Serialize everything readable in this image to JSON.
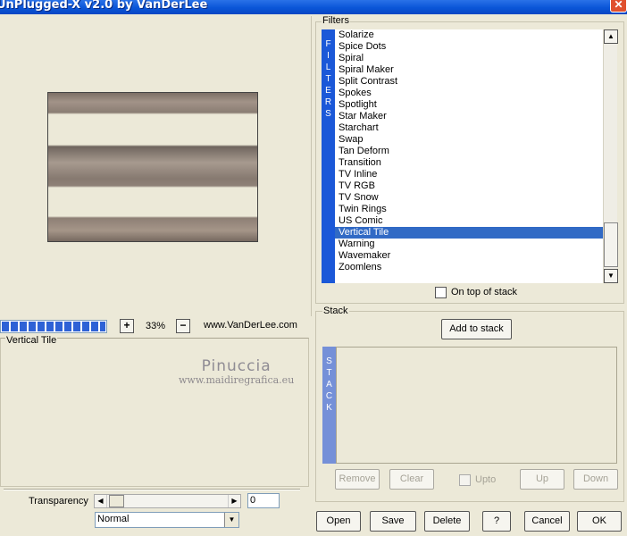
{
  "window": {
    "title": "UnPlugged-X v2.0 by VanDerLee",
    "close_glyph": "✕"
  },
  "zoom": {
    "progress": 1.0,
    "minus_glyph": "−",
    "plus_glyph": "+",
    "value": "33%",
    "website": "www.VanDerLee.com"
  },
  "params": {
    "title": "Vertical Tile",
    "watermark_name": "Pinuccia",
    "watermark_url": "www.maidiregrafica.eu",
    "transparency_label": "Transparency",
    "transparency_value": "0",
    "blend_mode": "Normal"
  },
  "filters": {
    "title": "Filters",
    "sidebar_letters": [
      "F",
      "I",
      "L",
      "T",
      "E",
      "R",
      "S"
    ],
    "items": [
      "Solarize",
      "Spice Dots",
      "Spiral",
      "Spiral Maker",
      "Split Contrast",
      "Spokes",
      "Spotlight",
      "Star Maker",
      "Starchart",
      "Swap",
      "Tan Deform",
      "Transition",
      "TV Inline",
      "TV RGB",
      "TV Snow",
      "Twin Rings",
      "US Comic",
      "Vertical Tile",
      "Warning",
      "Wavemaker",
      "Zoomlens"
    ],
    "selected": "Vertical Tile",
    "on_top_label": "On top of stack"
  },
  "stack": {
    "title": "Stack",
    "add_label": "Add to stack",
    "sidebar_letters": [
      "S",
      "T",
      "A",
      "C",
      "K"
    ],
    "remove_label": "Remove",
    "clear_label": "Clear",
    "upto_label": "Upto",
    "up_label": "Up",
    "down_label": "Down"
  },
  "footer": {
    "open_label": "Open",
    "save_label": "Save",
    "delete_label": "Delete",
    "help_label": "?",
    "cancel_label": "Cancel",
    "ok_label": "OK"
  },
  "colors": {
    "titlebar": "#0a55d8",
    "selection": "#316ac5",
    "filters_sidebar": "#1b58d8",
    "stack_sidebar": "#7590d8"
  },
  "icons": {
    "scroll_up": "triangle-up-icon",
    "scroll_down": "triangle-down-icon",
    "slider_left": "triangle-left-icon",
    "slider_right": "triangle-right-icon",
    "select_arrow": "triangle-down-icon"
  }
}
